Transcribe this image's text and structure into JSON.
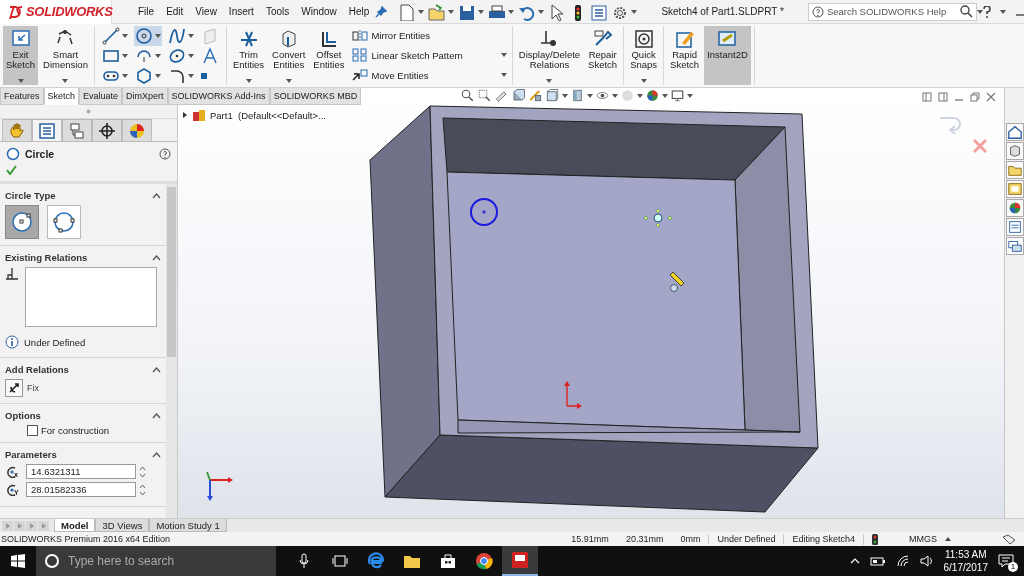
{
  "logo": "SOLIDWORKS",
  "menu": [
    "File",
    "Edit",
    "View",
    "Insert",
    "Tools",
    "Window",
    "Help"
  ],
  "window": {
    "title": "Sketch4 of Part1.SLDPRT *"
  },
  "search": {
    "placeholder": "Search SOLIDWORKS Help"
  },
  "ribbon": {
    "groups": [
      {
        "items": [
          {
            "kind": "large",
            "label": "Exit Sketch",
            "on": true,
            "has_menu": true
          },
          {
            "kind": "large",
            "label": "Smart Dimension",
            "on": false,
            "has_menu": true
          }
        ]
      },
      {
        "items": [
          {
            "kind": "tools",
            "tools": [
              {
                "kind": "line",
                "on": false
              },
              {
                "kind": "circle",
                "on": true
              },
              {
                "kind": "spline",
                "on": false
              },
              {
                "kind": "plane",
                "on": false
              },
              {
                "kind": "rectangle",
                "on": false
              },
              {
                "kind": "arc",
                "on": false
              },
              {
                "kind": "ellipse",
                "on": false
              },
              {
                "kind": "text",
                "on": false
              },
              {
                "kind": "slot",
                "on": false
              },
              {
                "kind": "polygon",
                "on": false
              },
              {
                "kind": "fillet",
                "on": false
              },
              {
                "kind": "point",
                "on": false
              }
            ]
          }
        ]
      },
      {
        "items": [
          {
            "kind": "large",
            "label": "Trim Entities",
            "on": false,
            "has_menu": true
          },
          {
            "kind": "large",
            "label": "Convert Entities",
            "on": false,
            "has_menu": true
          },
          {
            "kind": "large",
            "label": "Offset Entities",
            "on": false,
            "has_menu": false
          },
          {
            "kind": "list",
            "items": [
              "Mirror Entities",
              "Linear Sketch Pattern",
              "Move Entities"
            ]
          }
        ]
      },
      {
        "items": [
          {
            "kind": "large",
            "label": "Display/Delete Relations",
            "on": false,
            "has_menu": true
          },
          {
            "kind": "large",
            "label": "Repair Sketch",
            "on": false,
            "has_menu": false
          }
        ]
      },
      {
        "items": [
          {
            "kind": "large",
            "label": "Quick Snaps",
            "on": false,
            "has_menu": true
          }
        ]
      },
      {
        "items": [
          {
            "kind": "large",
            "label": "Rapid Sketch",
            "on": false,
            "has_menu": false
          },
          {
            "kind": "large",
            "label": "Instant2D",
            "on": true,
            "has_menu": false
          }
        ]
      }
    ]
  },
  "command_tabs": [
    {
      "label": "Features",
      "selected": false
    },
    {
      "label": "Sketch",
      "selected": true
    },
    {
      "label": "Evaluate",
      "selected": false
    },
    {
      "label": "DimXpert",
      "selected": false
    },
    {
      "label": "SOLIDWORKS Add-Ins",
      "selected": false
    },
    {
      "label": "SOLIDWORKS MBD",
      "selected": false
    }
  ],
  "panel_tabs": [
    {
      "selected": false
    },
    {
      "selected": true
    },
    {
      "selected": false
    },
    {
      "selected": false
    },
    {
      "selected": false
    }
  ],
  "property_manager": {
    "title": "Circle",
    "sections": [
      {
        "kind": "circle_type",
        "title": "Circle Type",
        "expanded": true,
        "options": [
          {
            "selected": true
          },
          {
            "selected": false
          }
        ]
      },
      {
        "kind": "relations",
        "title": "Existing Relations",
        "expanded": true,
        "status": "Under Defined"
      },
      {
        "kind": "add_relations",
        "title": "Add Relations",
        "expanded": true,
        "items": [
          "Fix"
        ]
      },
      {
        "kind": "options",
        "title": "Options",
        "expanded": true,
        "checkboxes": [
          {
            "label": "For construction",
            "checked": false
          }
        ]
      },
      {
        "kind": "parameters",
        "title": "Parameters",
        "expanded": true,
        "fields": [
          {
            "axis": "x",
            "value": "14.6321311"
          },
          {
            "axis": "Y",
            "value": "28.01582336"
          }
        ]
      }
    ]
  },
  "feature_tree": {
    "part": "Part1",
    "configuration": "(Default<<Default>...",
    "expanded": false
  },
  "bottom_tabs": [
    {
      "label": "Model",
      "selected": true
    },
    {
      "label": "3D Views",
      "selected": false
    },
    {
      "label": "Motion Study 1",
      "selected": false
    }
  ],
  "status_bar": {
    "edition": "SOLIDWORKS Premium 2016 x64 Edition",
    "fields": [
      "15.91mm",
      "20.31mm",
      "0mm",
      "Under Defined",
      "Editing Sketch4"
    ],
    "units": "MMGS"
  },
  "taskbar": {
    "search_placeholder": "Type here to search",
    "time": "11:53 AM",
    "date": "6/17/2017",
    "notifications": "1"
  }
}
